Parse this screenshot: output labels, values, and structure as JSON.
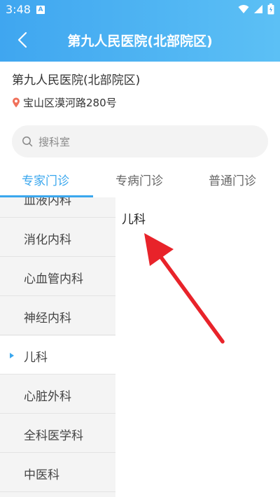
{
  "status_bar": {
    "time": "3:48",
    "notif": "A"
  },
  "header": {
    "title": "第九人民医院(北部院区)"
  },
  "hospital": {
    "name": "第九人民医院(北部院区)",
    "address": "宝山区漠河路280号"
  },
  "search": {
    "placeholder": "搜科室"
  },
  "tabs": [
    {
      "label": "专家门诊",
      "active": true
    },
    {
      "label": "专病门诊",
      "active": false
    },
    {
      "label": "普通门诊",
      "active": false
    }
  ],
  "departments": [
    {
      "label": "血液内科"
    },
    {
      "label": "消化内科"
    },
    {
      "label": "心血管内科"
    },
    {
      "label": "神经内科"
    },
    {
      "label": "儿科",
      "active": true
    },
    {
      "label": "心脏外科"
    },
    {
      "label": "全科医学科"
    },
    {
      "label": "中医科"
    }
  ],
  "sub_departments": [
    {
      "label": "儿科"
    }
  ],
  "colors": {
    "accent": "#3aa7ee",
    "header_start": "#3fa6f0",
    "header_end": "#5cc0f5",
    "arrow": "#e8232a"
  }
}
